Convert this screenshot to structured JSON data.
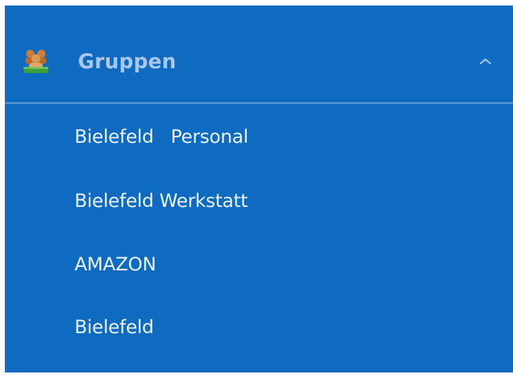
{
  "groups_section": {
    "title": "Gruppen",
    "icon": "group-users-icon",
    "expanded_indicator": "chevron-up-icon",
    "colors": {
      "panel_background": "#0e6bbf",
      "header_text": "#a7c7ee",
      "item_text": "#e9f1fb",
      "divider": "#4e92d4"
    },
    "items": [
      {
        "label": "Bielefeld   Personal"
      },
      {
        "label": "Bielefeld Werkstatt"
      },
      {
        "label": "AMAZON"
      },
      {
        "label": "Bielefeld"
      }
    ]
  }
}
